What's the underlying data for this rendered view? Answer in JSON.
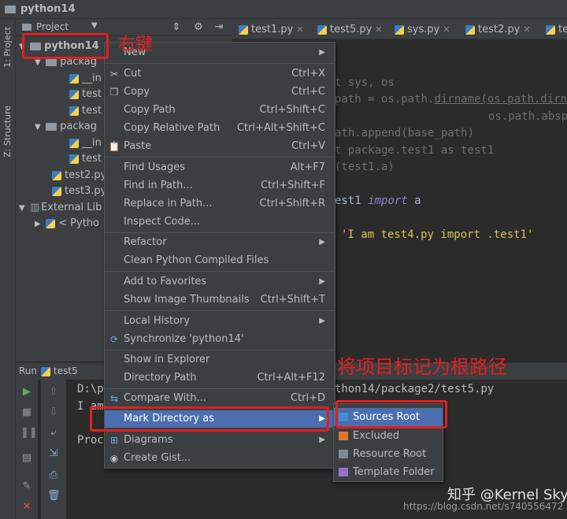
{
  "window": {
    "title": "python14"
  },
  "left_strip": {
    "project_label": "1: Project",
    "structure_label": "Z: Structure"
  },
  "project_panel": {
    "header": "Project",
    "tree": [
      {
        "label": "python14",
        "kind": "folder-open"
      },
      {
        "label": "packag",
        "kind": "folder-open"
      },
      {
        "label": "__in",
        "kind": "py"
      },
      {
        "label": "test",
        "kind": "py"
      },
      {
        "label": "test",
        "kind": "py"
      },
      {
        "label": "packag",
        "kind": "folder-open"
      },
      {
        "label": "__in",
        "kind": "py"
      },
      {
        "label": "test",
        "kind": "py"
      },
      {
        "label": "test2.py",
        "kind": "py"
      },
      {
        "label": "test3.py",
        "kind": "py"
      },
      {
        "label": "External Lib",
        "kind": "lib"
      },
      {
        "label": "< Pytho",
        "kind": "python"
      }
    ]
  },
  "tabs": [
    {
      "label": "test1.py"
    },
    {
      "label": "test5.py"
    },
    {
      "label": "sys.py"
    },
    {
      "label": "test2.py"
    },
    {
      "label": "te"
    }
  ],
  "editor": {
    "lines": [
      {
        "pre": "t sys, os",
        "kw": "",
        "post": ""
      },
      {
        "pre": "path = os.path.",
        "kw": "",
        "post": "dirname(os.path.dirn"
      },
      {
        "pre": "os.path.absp",
        "kw": "",
        "post": ""
      },
      {
        "pre": "ath.append(base_path)",
        "kw": "",
        "post": ""
      },
      {
        "pre": "t package.test1 as test1",
        "kw": "",
        "post": ""
      },
      {
        "pre": "(test1.a)",
        "kw": "",
        "post": ""
      },
      {
        "pre": "est1 ",
        "kw": "import",
        "post": " a"
      },
      {
        "pre": "'I am test4.py import .test1'",
        "kw": "",
        "post": ""
      }
    ]
  },
  "run_panel": {
    "label": "Run",
    "config": "test5",
    "console_lines": [
      "D:\\p",
      "I am",
      "Proc",
      "thon14/package2/test5.py"
    ]
  },
  "context_menu": {
    "items": [
      {
        "label": "New",
        "shortcut": "",
        "submenu": true
      },
      {
        "label": "Cut",
        "shortcut": "Ctrl+X",
        "icon": "cut-icon"
      },
      {
        "label": "Copy",
        "shortcut": "Ctrl+C",
        "icon": "copy-icon"
      },
      {
        "label": "Copy Path",
        "shortcut": "Ctrl+Shift+C"
      },
      {
        "label": "Copy Relative Path",
        "shortcut": "Ctrl+Alt+Shift+C"
      },
      {
        "label": "Paste",
        "shortcut": "Ctrl+V",
        "icon": "paste-icon"
      },
      {
        "label": "Find Usages",
        "shortcut": "Alt+F7"
      },
      {
        "label": "Find in Path...",
        "shortcut": "Ctrl+Shift+F"
      },
      {
        "label": "Replace in Path...",
        "shortcut": "Ctrl+Shift+R"
      },
      {
        "label": "Inspect Code...",
        "shortcut": ""
      },
      {
        "label": "Refactor",
        "shortcut": "",
        "submenu": true
      },
      {
        "label": "Clean Python Compiled Files",
        "shortcut": ""
      },
      {
        "label": "Add to Favorites",
        "shortcut": "",
        "submenu": true
      },
      {
        "label": "Show Image Thumbnails",
        "shortcut": "Ctrl+Shift+T"
      },
      {
        "label": "Local History",
        "shortcut": "",
        "submenu": true
      },
      {
        "label": "Synchronize 'python14'",
        "shortcut": "",
        "icon": "sync-icon"
      },
      {
        "label": "Show in Explorer",
        "shortcut": ""
      },
      {
        "label": "Directory Path",
        "shortcut": "Ctrl+Alt+F12"
      },
      {
        "label": "Compare With...",
        "shortcut": "Ctrl+D",
        "icon": "compare-icon"
      },
      {
        "label": "Mark Directory as",
        "shortcut": "",
        "submenu": true,
        "selected": true
      },
      {
        "label": "Diagrams",
        "shortcut": "",
        "submenu": true,
        "icon": "diagram-icon"
      },
      {
        "label": "Create Gist...",
        "shortcut": "",
        "icon": "github-icon"
      }
    ]
  },
  "submenu": {
    "items": [
      {
        "label": "Sources Root",
        "color": "#3d8fd6",
        "selected": true
      },
      {
        "label": "Excluded",
        "color": "#d9772a"
      },
      {
        "label": "Resource Root",
        "color": "#7d8b95"
      },
      {
        "label": "Template Folder",
        "color": "#9b6fc4"
      }
    ]
  },
  "annotations": {
    "right_click": "右键",
    "mark_root": "将项目标记为根路径"
  },
  "watermark": {
    "brand": "知乎 @Kernel Sky",
    "url": "https://blog.csdn.net/s740556472"
  },
  "colors": {
    "menu_bg": "#3c3f41",
    "selection": "#4b6eaf",
    "annotation_red": "#e02020",
    "editor_bg": "#2b2b2b"
  }
}
